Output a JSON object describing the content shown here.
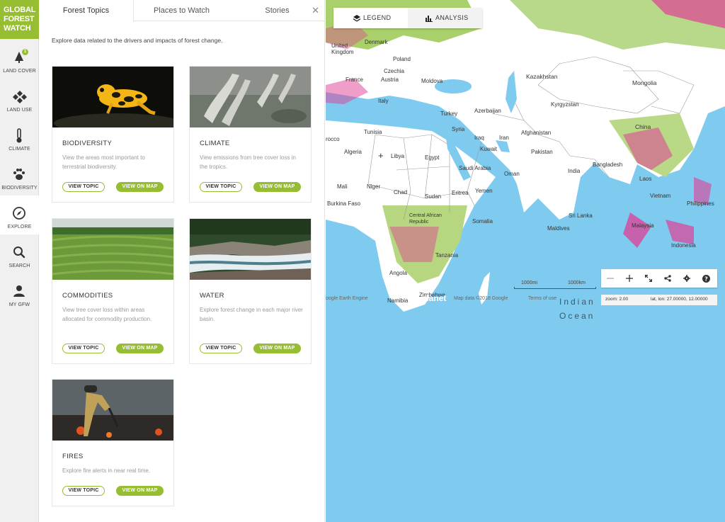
{
  "brand": {
    "line1": "GLOBAL",
    "line2": "FOREST",
    "line3": "WATCH",
    "color": "#97be32"
  },
  "rail": [
    {
      "label": "LAND COVER",
      "icon": "tree-icon",
      "badge": "1"
    },
    {
      "label": "LAND USE",
      "icon": "layers-diamond-icon"
    },
    {
      "label": "CLIMATE",
      "icon": "thermometer-icon"
    },
    {
      "label": "BIODIVERSITY",
      "icon": "paw-icon"
    },
    {
      "label": "EXPLORE",
      "icon": "compass-icon",
      "active": true
    },
    {
      "label": "SEARCH",
      "icon": "search-icon"
    },
    {
      "label": "MY GFW",
      "icon": "user-icon"
    }
  ],
  "tabs": [
    "Forest Topics",
    "Places to Watch",
    "Stories"
  ],
  "intro": "Explore data related to the drivers and impacts of forest change.",
  "buttons": {
    "view_topic": "VIEW TOPIC",
    "view_on_map": "VIEW ON MAP"
  },
  "topics": [
    {
      "title": "BIODIVERSITY",
      "desc": "View the areas most important to terrestrial biodiversity."
    },
    {
      "title": "CLIMATE",
      "desc": "View emissions from tree cover loss in the tropics."
    },
    {
      "title": "COMMODITIES",
      "desc": "View tree cover loss within areas allocated for commodity production."
    },
    {
      "title": "WATER",
      "desc": "Explore forest change in each major river basin."
    },
    {
      "title": "FIRES",
      "desc": "Explore fire alerts in near real time."
    }
  ],
  "map": {
    "legend_label": "LEGEND",
    "analysis_label": "ANALYSIS",
    "labels": {
      "united_kingdom": "United\nKingdom",
      "denmark": "Denmark",
      "poland": "Poland",
      "france": "France",
      "austria": "Austria",
      "czechia": "Czechia",
      "moldova": "Moldova",
      "italy": "Italy",
      "kazakhstan": "Kazakhstan",
      "mongolia": "Mongolia",
      "kyrgyzstan": "Kyrgyzstan",
      "turkey": "Turkey",
      "azerbaijan": "Azerbaijan",
      "syria": "Syria",
      "tunisia": "Tunisia",
      "morocco": "rocco",
      "algeria": "Algeria",
      "libya": "Libya",
      "egypt": "Egypt",
      "iraq": "Iraq",
      "kuwait": "Kuwait",
      "iran": "Iran",
      "afghanistan": "Afghanistan",
      "pakistan": "Pakistan",
      "china": "China",
      "saudi": "Saudi Arabia",
      "oman": "Oman",
      "india": "India",
      "bangladesh": "Bangladesh",
      "mali": "Mali",
      "niger": "Niger",
      "chad": "Chad",
      "sudan": "Sudan",
      "eritrea": "Eritrea",
      "yemen": "Yemen",
      "laos": "Laos",
      "vietnam": "Vietnam",
      "philippines": "Philippines",
      "burkina": "Burkina Faso",
      "car": "Central African\nRepublic",
      "somalia": "Somalia",
      "sri_lanka": "Sri Lanka",
      "maldives": "Maldives",
      "malaysia": "Malaysia",
      "indonesia": "Indonesia",
      "tanzania": "Tanzania",
      "angola": "Angola",
      "zimbabwe": "Zimbabwe",
      "namibia": "Namibia"
    },
    "ocean": "Indian\nOcean",
    "scale_mi": "1000mi",
    "scale_km": "1000km",
    "attribution": {
      "google": "oogle Earth Engine",
      "planet": "planet",
      "data": "Map data ©2018 Google",
      "terms": "Terms of use"
    },
    "zoom_label": "zoom: 2.00",
    "latlon_label": "lat, lon: 27.00000, 12.00000",
    "colors": {
      "ocean": "#7fcbf0",
      "land": "#ffffff",
      "forest": "#a9d06a",
      "loss": "#e03e95"
    }
  }
}
